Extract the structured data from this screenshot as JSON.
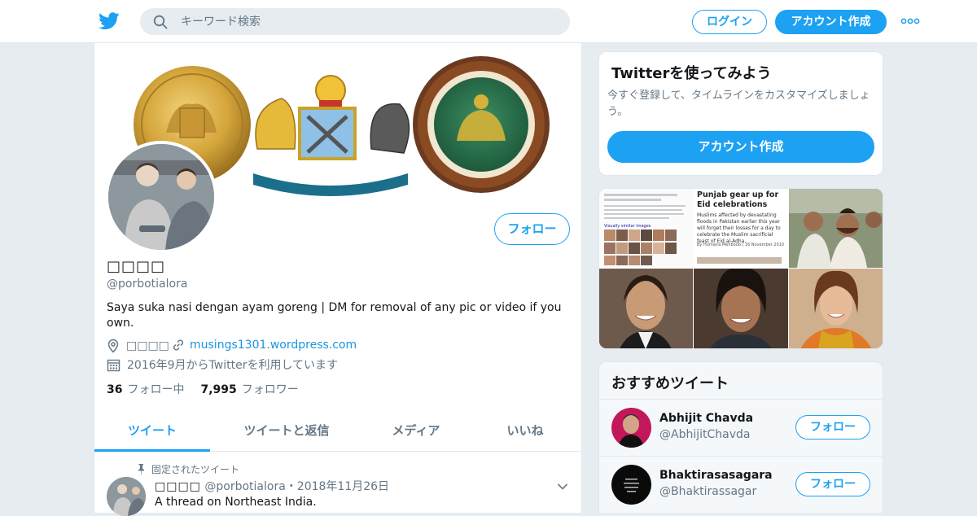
{
  "topbar": {
    "logo_icon": "twitter-bird-icon",
    "search_placeholder": "キーワード検索",
    "login_label": "ログイン",
    "signup_label": "アカウント作成",
    "more_icon": "more-dots-icon",
    "accent_color": "#1da1f2"
  },
  "profile": {
    "display_name": "□□□□",
    "handle": "@porbotialora",
    "follow_label": "フォロー",
    "bio": "Saya suka nasi dengan ayam goreng | DM for removal of any pic or video if you own.",
    "location": "□□□□",
    "website": "musings1301.wordpress.com",
    "joined": "2016年9月からTwitterを利用しています",
    "following_count": "36",
    "following_label": "フォロー中",
    "followers_count": "7,995",
    "followers_label": "フォロワー"
  },
  "tabs": [
    {
      "label": "ツイート",
      "active": true
    },
    {
      "label": "ツイートと返信",
      "active": false
    },
    {
      "label": "メディア",
      "active": false
    },
    {
      "label": "いいね",
      "active": false
    }
  ],
  "pinned_tweet": {
    "pinned_label": "固定されたツイート",
    "name": "□□□□",
    "handle": "@porbotialora",
    "separator": "・",
    "date": "2018年11月26日",
    "text": "A thread on Northeast India."
  },
  "signup_card": {
    "title": "Twitterを使ってみよう",
    "description": "今すぐ登録して、タイムラインをカスタマイズしましょう。",
    "button_label": "アカウント作成"
  },
  "media_grid": {
    "tile_2_headline": "Punjab gear up for Eid celebrations",
    "tile_2_body": "Muslims affected by devastating floods in Pakistan earlier this year will forget their losses for a day to celebrate the Muslim sacrificial feast of Eid al-Adha.",
    "tile_2_byline": "By Humaira Mehboob | 16 November 2010",
    "tile_1_caption": "Visually similar images"
  },
  "recommendations": {
    "title": "おすすめツイート",
    "follow_label": "フォロー",
    "items": [
      {
        "name": "Abhijit Chavda",
        "handle": "@AbhijitChavda"
      },
      {
        "name": "Bhaktirasasagara",
        "handle": "@Bhaktirassagar"
      }
    ]
  }
}
